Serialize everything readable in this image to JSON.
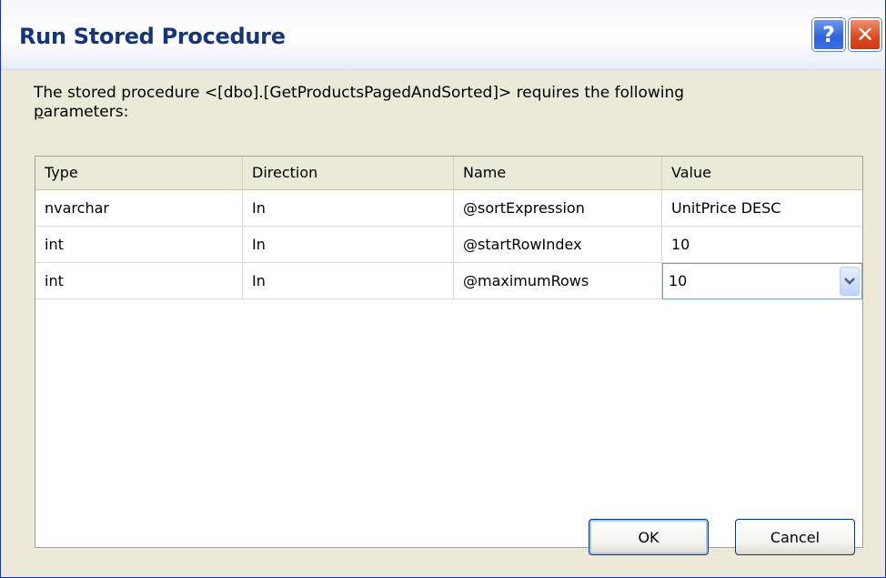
{
  "window": {
    "title": "Run Stored Procedure",
    "help_label": "?",
    "close_label": "✕"
  },
  "description": {
    "line1": "The stored procedure <[dbo].[GetProductsPagedAndSorted]> requires the following",
    "line2_prefix": "p",
    "line2_rest": "arameters:"
  },
  "grid": {
    "columns": [
      "Type",
      "Direction",
      "Name",
      "Value"
    ],
    "rows": [
      {
        "type": "nvarchar",
        "direction": "In",
        "name": "@sortExpression",
        "value": "UnitPrice DESC"
      },
      {
        "type": "int",
        "direction": "In",
        "name": "@startRowIndex",
        "value": "10"
      },
      {
        "type": "int",
        "direction": "In",
        "name": "@maximumRows",
        "value": "10"
      }
    ]
  },
  "buttons": {
    "ok": "OK",
    "cancel": "Cancel"
  },
  "colors": {
    "title_text": "#15367e",
    "dialog_bg": "#ece9d8",
    "help_button": "#2e63db",
    "close_button": "#e0471d"
  },
  "icons": {
    "help": "question-icon",
    "close": "close-icon",
    "dropdown": "chevron-down-icon"
  }
}
